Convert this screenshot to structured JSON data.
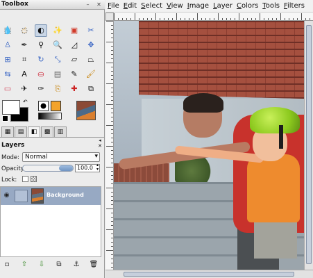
{
  "toolbox": {
    "title": "Toolbox",
    "tools": [
      "rect-select-icon",
      "ellipse-select-icon",
      "free-select-icon",
      "fuzzy-select-icon",
      "color-select-icon",
      "scissors-icon",
      "foreground-select-icon",
      "paths-icon",
      "color-picker-icon",
      "zoom-icon",
      "measure-icon",
      "move-icon",
      "align-icon",
      "crop-icon",
      "rotate-icon",
      "scale-icon",
      "shear-icon",
      "perspective-icon",
      "flip-icon",
      "text-icon",
      "bucket-fill-icon",
      "blend-icon",
      "pencil-icon",
      "paintbrush-icon",
      "eraser-icon",
      "airbrush-icon",
      "ink-icon",
      "clone-icon",
      "heal-icon",
      "perspective-clone-icon",
      "blur-icon",
      "smudge-icon",
      "dodge-burn-icon"
    ],
    "active_tool": "dodge-burn-icon",
    "fg_color": "#ffffff",
    "bg_color": "#000000"
  },
  "layers": {
    "title": "Layers",
    "mode_label": "Mode:",
    "mode_value": "Normal",
    "opacity_label": "Opacity:",
    "opacity_value": "100.0",
    "opacity_percent": 100,
    "lock_label": "Lock:",
    "items": [
      {
        "name": "Background",
        "visible": true,
        "selected": true
      }
    ]
  },
  "image_window": {
    "menus": [
      "File",
      "Edit",
      "Select",
      "View",
      "Image",
      "Layer",
      "Colors",
      "Tools",
      "Filters"
    ],
    "menu_accel_index": [
      0,
      0,
      0,
      0,
      0,
      0,
      0,
      0,
      0
    ]
  },
  "colors": {
    "selection_row": "#97a9c3",
    "scrollbar_thumb": "#c6cfdc"
  }
}
